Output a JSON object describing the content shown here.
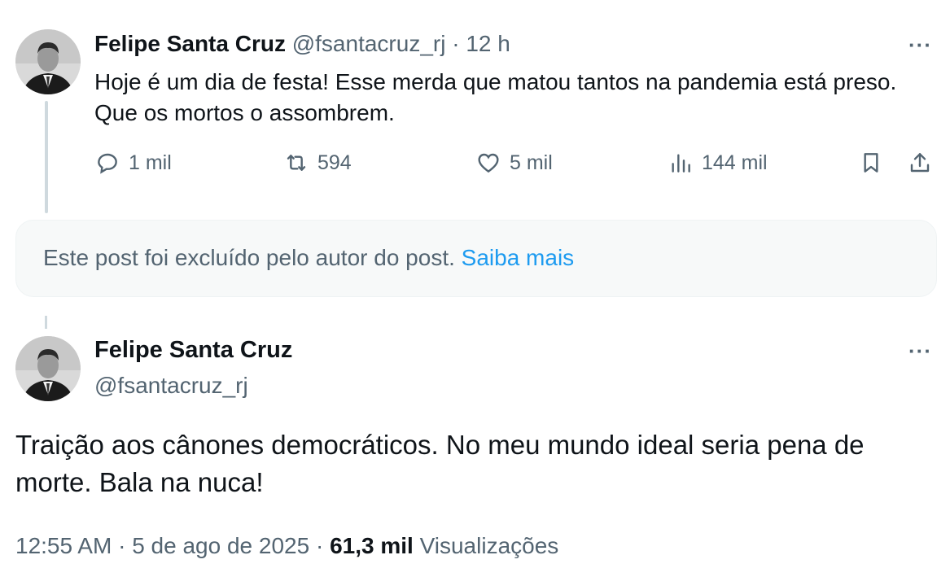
{
  "tweet1": {
    "author_name": "Felipe Santa Cruz",
    "handle": "@fsantacruz_rj",
    "separator": "·",
    "time": "12 h",
    "more_label": "···",
    "text": "Hoje é um dia de festa! Esse merda que matou tantos na pandemia está preso. Que os mortos o assombrem.",
    "actions": {
      "replies": "1 mil",
      "reposts": "594",
      "likes": "5 mil",
      "views": "144 mil"
    }
  },
  "deleted_notice": {
    "text": "Este post foi excluído pelo autor do post.",
    "link": "Saiba mais"
  },
  "tweet2": {
    "author_name": "Felipe Santa Cruz",
    "handle": "@fsantacruz_rj",
    "more_label": "···",
    "text": "Traição aos cânones democráticos. No meu mundo ideal seria pena de morte. Bala na nuca!",
    "timestamp": "12:55 AM",
    "separator": "·",
    "date": "5 de ago de 2025",
    "views_count": "61,3 mil",
    "views_label": "Visualizações"
  },
  "icons": {
    "reply": "reply-icon",
    "repost": "repost-icon",
    "like": "heart-icon",
    "views": "views-chart-icon",
    "bookmark": "bookmark-icon",
    "share": "share-icon"
  },
  "colors": {
    "text": "#0f1419",
    "secondary": "#536471",
    "link": "#1d9bf0",
    "notice_bg": "#f7f9f9"
  }
}
